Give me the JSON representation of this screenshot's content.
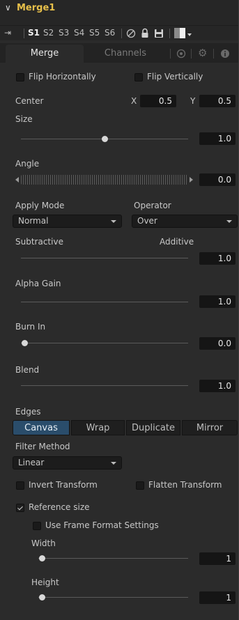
{
  "node": {
    "title": "Merge1"
  },
  "toolbar": {
    "slots": [
      "S1",
      "S2",
      "S3",
      "S4",
      "S5",
      "S6"
    ],
    "active_slot": "S1"
  },
  "tabs": [
    {
      "label": "Merge",
      "active": true
    },
    {
      "label": "Channels",
      "active": false
    }
  ],
  "flip": {
    "horizontal_label": "Flip Horizontally",
    "vertical_label": "Flip Vertically"
  },
  "center": {
    "label": "Center",
    "x_label": "X",
    "x_value": "0.5",
    "y_label": "Y",
    "y_value": "0.5"
  },
  "size": {
    "label": "Size",
    "value": "1.0",
    "level": 0.5
  },
  "angle": {
    "label": "Angle",
    "value": "0.0"
  },
  "apply_mode": {
    "label": "Apply Mode",
    "value": "Normal"
  },
  "operator": {
    "label": "Operator",
    "value": "Over"
  },
  "blend_mode": {
    "left_label": "Subtractive",
    "right_label": "Additive",
    "value": "1.0",
    "level": 1.0
  },
  "alpha_gain": {
    "label": "Alpha Gain",
    "value": "1.0",
    "level": 1.0
  },
  "burn_in": {
    "label": "Burn In",
    "value": "0.0",
    "level": 0.0
  },
  "blend": {
    "label": "Blend",
    "value": "1.0",
    "level": 1.0
  },
  "edges": {
    "label": "Edges",
    "options": [
      "Canvas",
      "Wrap",
      "Duplicate",
      "Mirror"
    ],
    "selected": "Canvas"
  },
  "filter_method": {
    "label": "Filter Method",
    "value": "Linear"
  },
  "transform": {
    "invert_label": "Invert Transform",
    "flatten_label": "Flatten Transform"
  },
  "reference_size": {
    "label": "Reference size",
    "checked": true,
    "use_frame_format_label": "Use Frame Format Settings",
    "width_label": "Width",
    "width_value": "1",
    "height_label": "Height",
    "height_value": "1"
  },
  "colors": {
    "accent_title": "#e8c04a",
    "selected_button": "#2a4d6b",
    "panel_bg": "#2b2b2b"
  }
}
